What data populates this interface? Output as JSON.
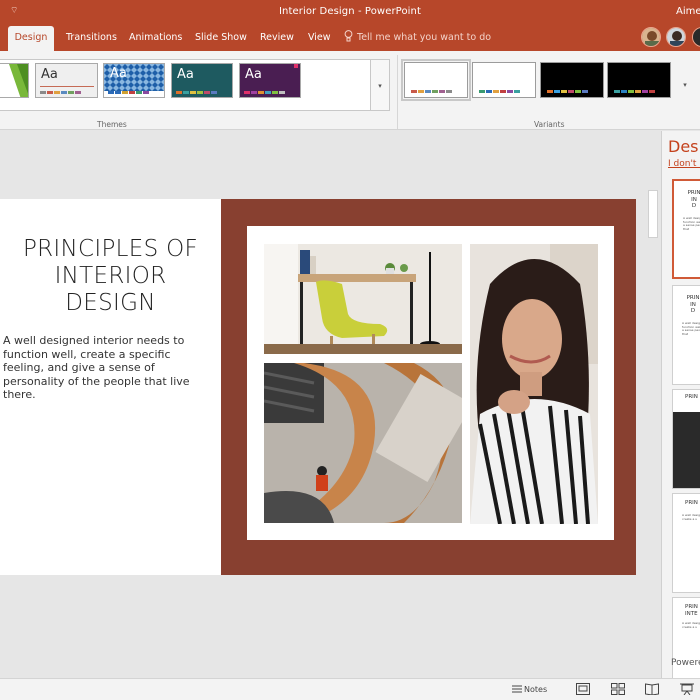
{
  "window": {
    "title": "Interior Design  -  PowerPoint",
    "user": "Aimee",
    "qat_glyph": "⌔"
  },
  "tabs": [
    {
      "label": "Design",
      "active": true
    },
    {
      "label": "Transitions",
      "active": false
    },
    {
      "label": "Animations",
      "active": false
    },
    {
      "label": "Slide Show",
      "active": false
    },
    {
      "label": "Review",
      "active": false
    },
    {
      "label": "View",
      "active": false
    }
  ],
  "tell_me": {
    "placeholder": "Tell me what you want to do"
  },
  "ribbon": {
    "themes_label": "Themes",
    "variants_label": "Variants",
    "theme_sample": "Aa",
    "more_glyph": "▾"
  },
  "slide": {
    "title_lines": [
      "PRINCIPLES OF",
      "INTERIOR",
      "DESIGN"
    ],
    "body": "A well designed interior needs to function well, create a specific feeling, and give a sense of personality of the people that live there."
  },
  "design_pane": {
    "title": "Desig",
    "link": "I don't r",
    "thumb_title": "PRIN\nIN\nD",
    "footer": "Powere"
  },
  "status": {
    "notes_label": "Notes"
  },
  "colors": {
    "accent": "#b7472a",
    "slide_brown": "#884030",
    "pane_orange": "#c4421d"
  }
}
